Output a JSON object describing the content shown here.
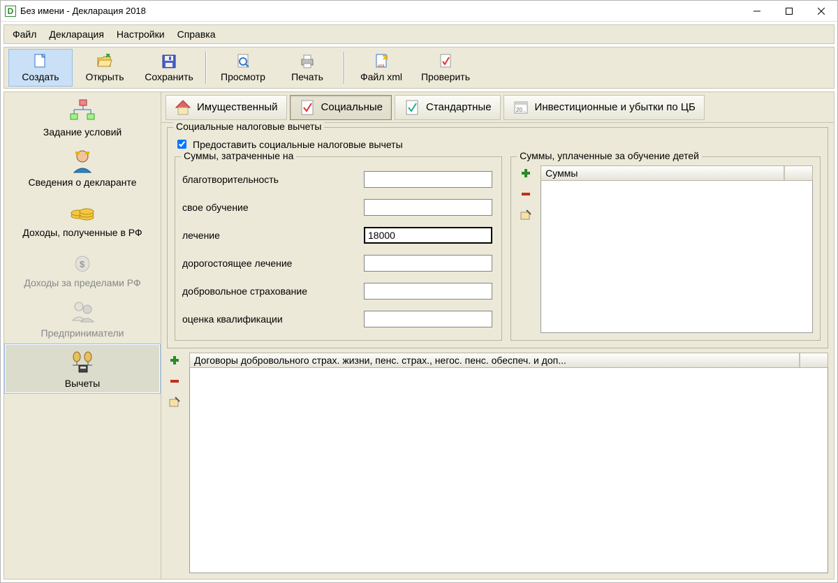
{
  "window": {
    "title": "Без имени - Декларация 2018"
  },
  "menu": {
    "file": "Файл",
    "declaration": "Декларация",
    "settings": "Настройки",
    "help": "Справка"
  },
  "toolbar": {
    "create": "Создать",
    "open": "Открыть",
    "save": "Сохранить",
    "preview": "Просмотр",
    "print": "Печать",
    "xml": "Файл xml",
    "check": "Проверить"
  },
  "nav": {
    "conditions": "Задание условий",
    "declarant": "Сведения о декларанте",
    "income_rf": "Доходы, полученные в РФ",
    "income_abroad": "Доходы за пределами РФ",
    "entrepreneur": "Предприниматели",
    "deductions": "Вычеты"
  },
  "tabs": {
    "property": "Имущественный",
    "social": "Социальные",
    "standard": "Стандартные",
    "invest": "Инвестиционные и убытки по ЦБ"
  },
  "fieldset": {
    "title": "Социальные налоговые вычеты",
    "provide": "Предоставить социальные налоговые вычеты"
  },
  "spent": {
    "title": "Суммы, затраченные на",
    "charity": "благотворительность",
    "own_education": "свое обучение",
    "treatment": "лечение",
    "expensive_treatment": "дорогостоящее лечение",
    "voluntary_insurance": "добровольное страхование",
    "qualification": "оценка квалификации",
    "values": {
      "charity": "",
      "own_education": "",
      "treatment": "18000",
      "expensive_treatment": "",
      "voluntary_insurance": "",
      "qualification": ""
    }
  },
  "children_edu": {
    "title": "Суммы, уплаченные за обучение детей",
    "header": "Суммы"
  },
  "contracts": {
    "header": "Договоры добровольного страх. жизни, пенс. страх., негос. пенс. обеспеч. и доп..."
  }
}
